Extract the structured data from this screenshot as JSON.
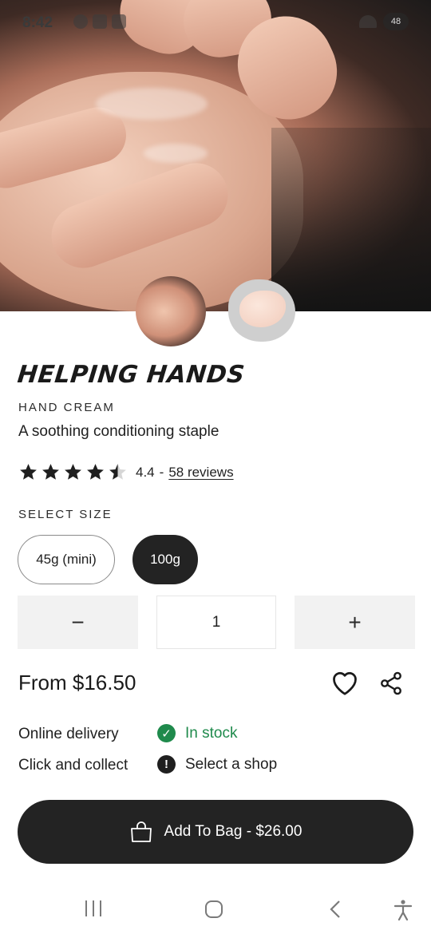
{
  "status_bar": {
    "time": "8:42",
    "battery": "48"
  },
  "product": {
    "name": "HELPING HANDS",
    "category": "HAND CREAM",
    "tagline": "A soothing conditioning staple",
    "rating": "4.4",
    "rating_separator": "-",
    "reviews_label": "58 reviews",
    "rating_value": 4.4
  },
  "size": {
    "label": "SELECT SIZE",
    "options": [
      "45g (mini)",
      "100g"
    ],
    "selected": "100g"
  },
  "quantity": {
    "decrement": "−",
    "value": "1",
    "increment": "+"
  },
  "price": "From $16.50",
  "availability": {
    "delivery_label": "Online delivery",
    "delivery_status": "In stock",
    "collect_label": "Click and collect",
    "collect_status": "Select a shop"
  },
  "cta": {
    "label": "Add To Bag - $26.00"
  },
  "colors": {
    "primary": "#232323",
    "success": "#1f8a4c",
    "neutral_bg": "#f2f2f2"
  },
  "icons": [
    "heart-icon",
    "share-icon",
    "bag-icon",
    "check-circle-icon",
    "alert-circle-icon",
    "star-icon"
  ],
  "nav": [
    "recents-icon",
    "home-icon",
    "back-icon",
    "accessibility-icon"
  ]
}
